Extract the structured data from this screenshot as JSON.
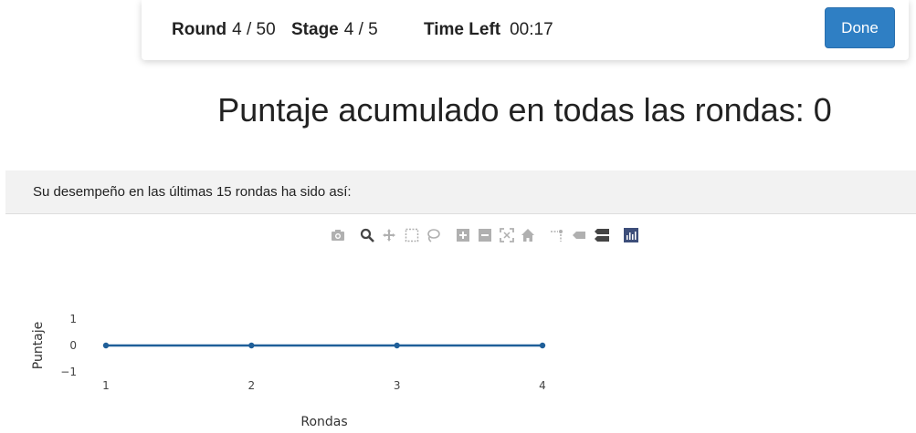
{
  "header": {
    "round_label": "Round",
    "round_value": "4 / 50",
    "stage_label": "Stage",
    "stage_value": "4 / 5",
    "time_label": "Time Left",
    "time_value": "00:17",
    "done_label": "Done"
  },
  "score_heading": "Puntaje acumulado en todas las rondas: 0",
  "performance_text": "Su desempeño en las últimas 15 rondas ha sido así:",
  "modebar": {
    "icons": [
      "camera-icon",
      "zoom-icon",
      "pan-icon",
      "box-select-icon",
      "lasso-select-icon",
      "zoom-in-icon",
      "zoom-out-icon",
      "autoscale-icon",
      "reset-axes-icon",
      "spike-lines-icon",
      "hover-closest-icon",
      "hover-compare-icon",
      "plotly-logo-icon"
    ]
  },
  "chart_data": {
    "type": "line",
    "x": [
      1,
      2,
      3,
      4
    ],
    "y": [
      0,
      0,
      0,
      0
    ],
    "xlabel": "Rondas",
    "ylabel": "Puntaje",
    "xlim": [
      1,
      4
    ],
    "ylim": [
      -1,
      1
    ],
    "xticks": [
      "1",
      "2",
      "3",
      "4"
    ],
    "yticks": [
      "1",
      "0",
      "−1"
    ],
    "line_color": "#1f5f99",
    "grid": false
  }
}
